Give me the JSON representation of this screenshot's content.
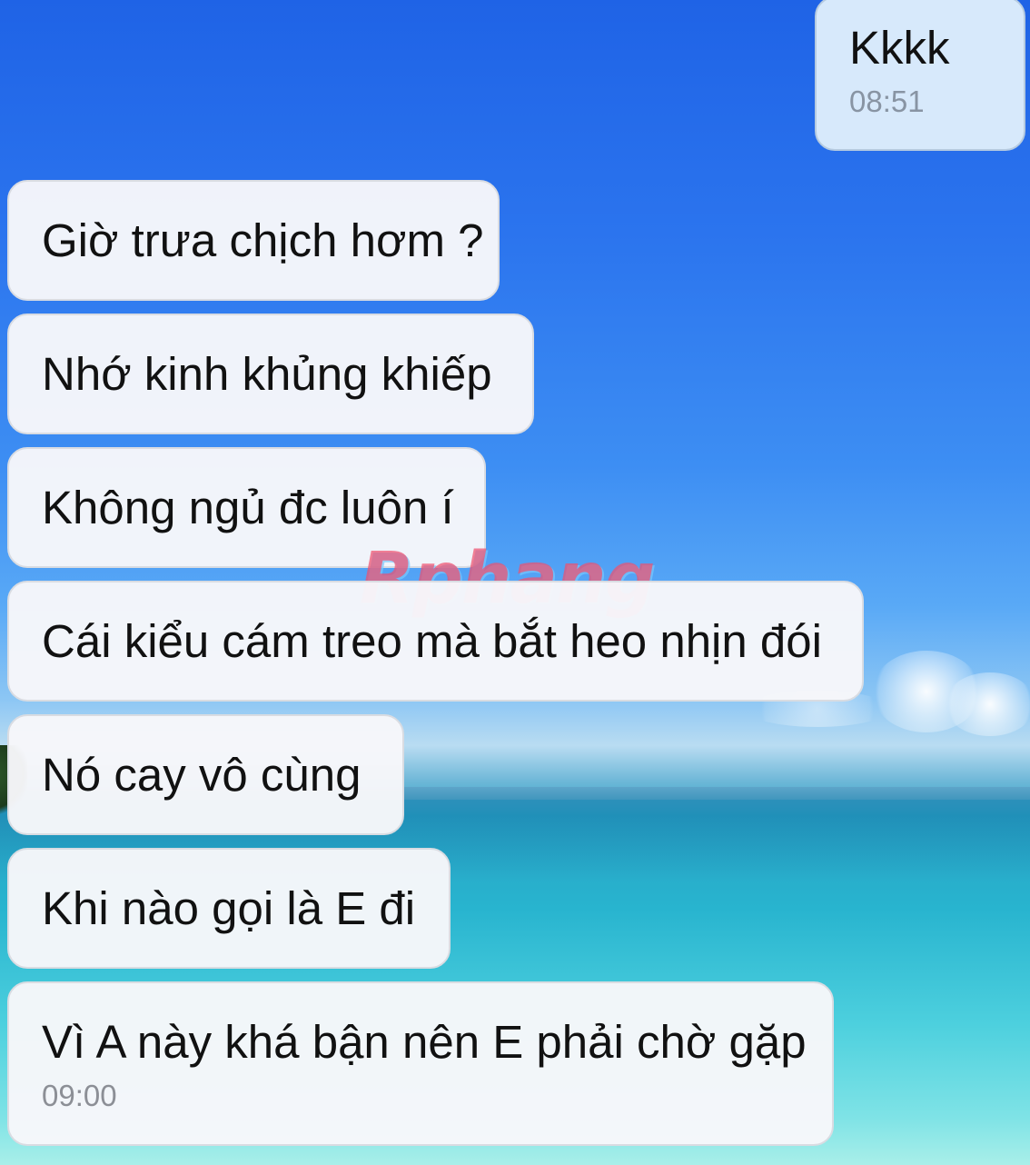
{
  "chat": {
    "messages": [
      {
        "sender": "me",
        "text": "Kkkk",
        "time": "08:51"
      },
      {
        "sender": "other",
        "text": "Giờ trưa chịch hơm ?"
      },
      {
        "sender": "other",
        "text": "Nhớ kinh khủng khiếp"
      },
      {
        "sender": "other",
        "text": "Không ngủ đc luôn í"
      },
      {
        "sender": "other",
        "text": "Cái kiểu cám treo mà bắt heo nhịn đói"
      },
      {
        "sender": "other",
        "text": "Nó cay vô cùng"
      },
      {
        "sender": "other",
        "text": "Khi nào gọi là E đi"
      },
      {
        "sender": "other",
        "text": "Vì A này khá bận nên E phải chờ gặp",
        "time": "09:00"
      }
    ]
  },
  "watermark": {
    "text": "Rphang"
  },
  "colors": {
    "incoming_bubble": "#f7f7fa",
    "outgoing_bubble": "#d7e9fb",
    "timestamp": "#8c8f96"
  }
}
